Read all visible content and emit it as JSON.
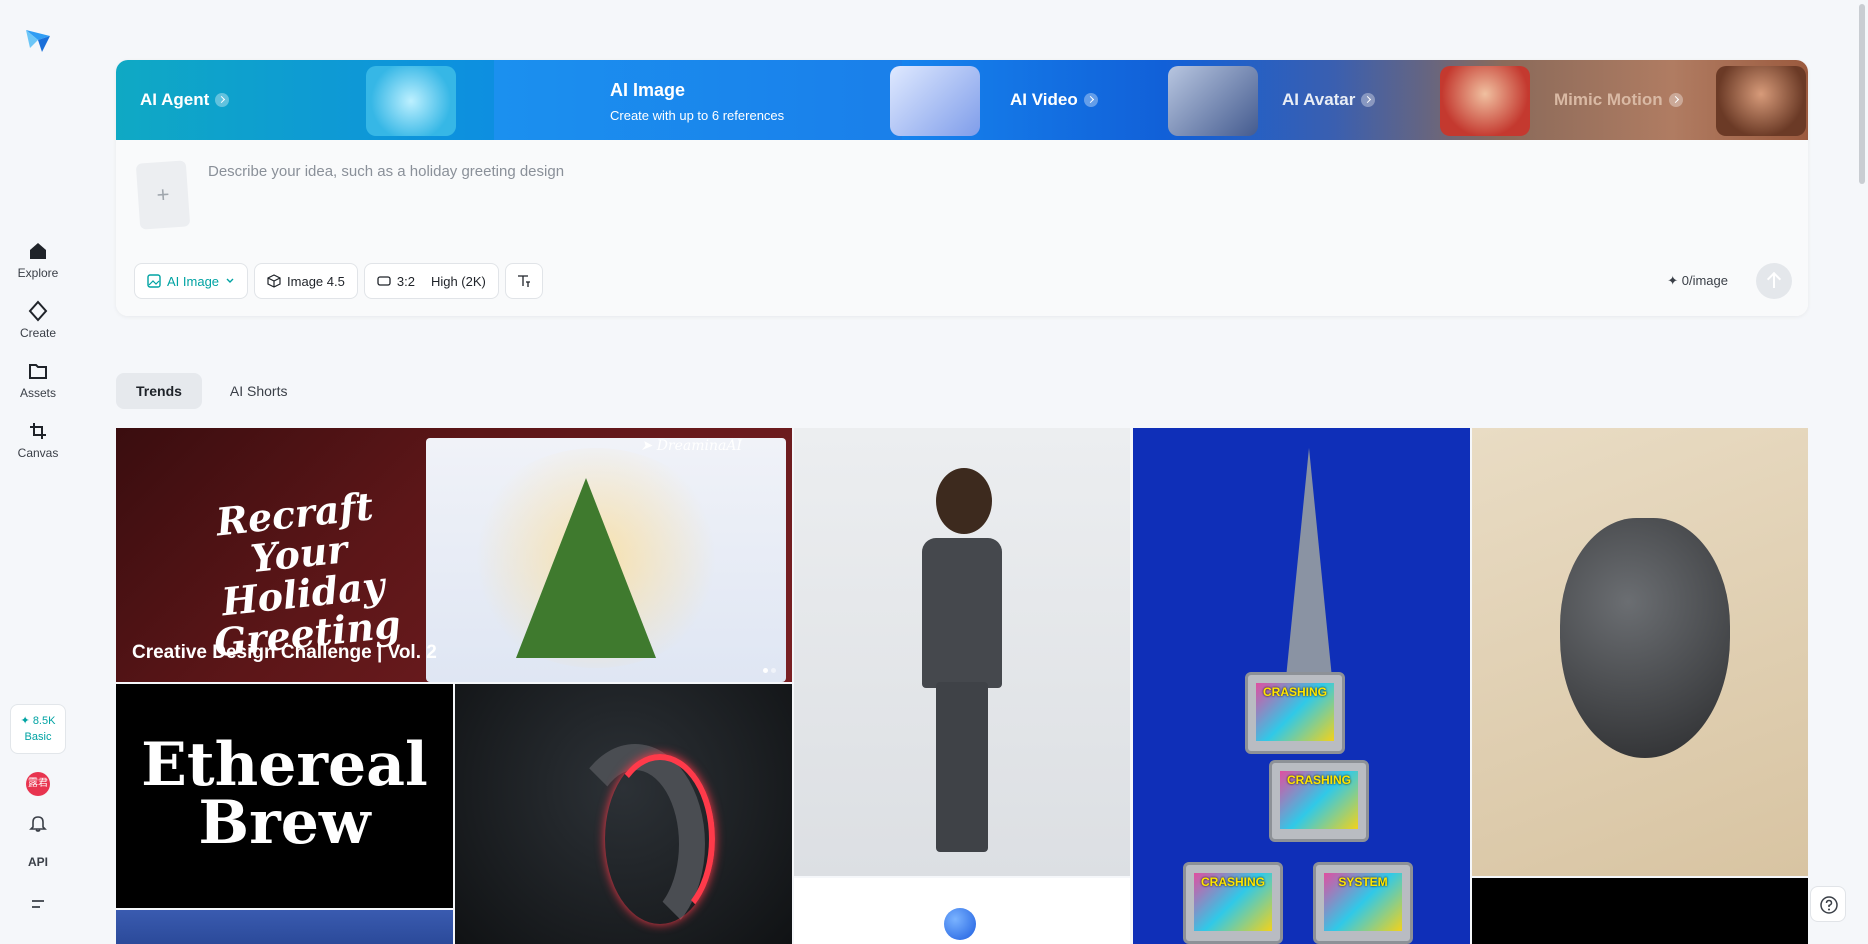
{
  "sidebar": {
    "nav": [
      {
        "id": "explore",
        "label": "Explore",
        "icon": "home-icon"
      },
      {
        "id": "create",
        "label": "Create",
        "icon": "create-diamond-icon"
      },
      {
        "id": "assets",
        "label": "Assets",
        "icon": "folder-icon"
      },
      {
        "id": "canvas",
        "label": "Canvas",
        "icon": "canvas-crop-icon"
      }
    ],
    "credits": {
      "amount": "8.5K",
      "plan": "Basic"
    },
    "avatar_initials": "露君",
    "api_label": "API"
  },
  "modes": {
    "agent": "AI Agent",
    "image": {
      "title": "AI Image",
      "subtitle": "Create with up to 6 references"
    },
    "video": "AI Video",
    "avatar": "AI Avatar",
    "motion": "Mimic Motion"
  },
  "prompt": {
    "placeholder": "Describe your idea, such as a holiday greeting design",
    "add_symbol": "+"
  },
  "toolbar": {
    "type_label": "AI Image",
    "model_label": "Image 4.5",
    "ratio_label": "3:2",
    "quality_label": "High (2K)",
    "cost_label": "0/image"
  },
  "tabs": [
    {
      "label": "Trends",
      "active": true
    },
    {
      "label": "AI Shorts",
      "active": false
    }
  ],
  "gallery": {
    "banner": {
      "script_text": "Recraft Your Holiday Greeting",
      "brand": "DreaminaAI",
      "caption": "Creative Design Challenge | Vol. 2"
    },
    "brew_text": "Ethereal Brew",
    "tower_screens": [
      "CRASHING",
      "CRASHING",
      "CRASHING",
      "SYSTEM"
    ]
  },
  "colors": {
    "accent": "#00a3a3",
    "mode_blue": "#1687f0",
    "avatar": "#e8344f"
  }
}
